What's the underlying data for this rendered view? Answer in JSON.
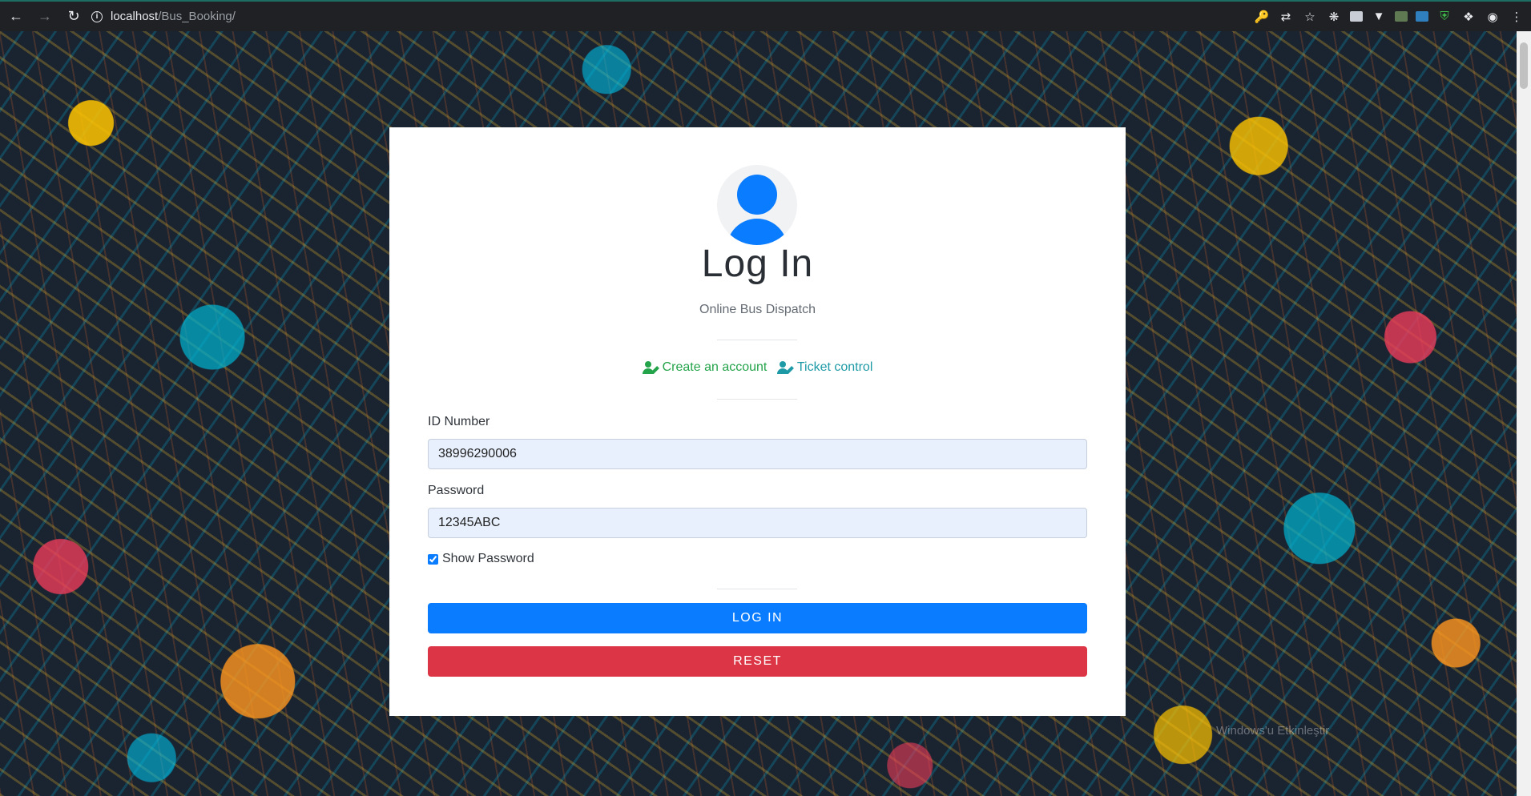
{
  "browser": {
    "url_host": "localhost",
    "url_path": "/Bus_Booking/"
  },
  "login": {
    "title": "Log In",
    "subtitle": "Online Bus Dispatch",
    "links": {
      "create_account": "Create an account",
      "ticket_control": "Ticket control"
    },
    "id_field": {
      "label": "ID Number",
      "value": "38996290006"
    },
    "password_field": {
      "label": "Password",
      "value": "12345ABC"
    },
    "show_password": {
      "label": "Show Password",
      "checked": true
    },
    "login_button": "LOG IN",
    "reset_button": "RESET"
  },
  "colors": {
    "primary": "#0a7cff",
    "danger": "#dc3545",
    "create_link": "#23a34a",
    "ticket_link": "#1d9aa6",
    "input_bg": "#e8f0fe"
  },
  "watermark": {
    "line1": "Windows'u Etkinleştir"
  }
}
